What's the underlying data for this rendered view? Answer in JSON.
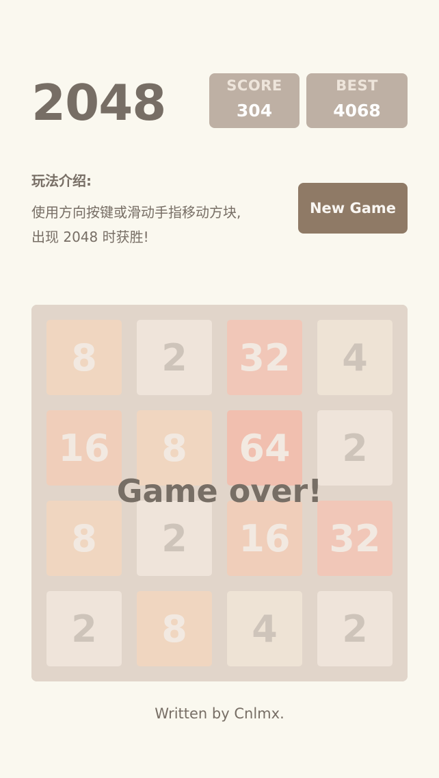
{
  "header": {
    "title": "2048",
    "score": {
      "label": "SCORE",
      "value": "304"
    },
    "best": {
      "label": "BEST",
      "value": "4068"
    }
  },
  "intro": {
    "heading": "玩法介绍:",
    "line1": "使用方向按键或滑动手指移动方块,",
    "line2": "出现 2048 时获胜!"
  },
  "controls": {
    "new_game_label": "New Game"
  },
  "board": {
    "rows": [
      [
        "8",
        "2",
        "32",
        "4"
      ],
      [
        "16",
        "8",
        "64",
        "2"
      ],
      [
        "8",
        "2",
        "16",
        "32"
      ],
      [
        "2",
        "8",
        "4",
        "2"
      ]
    ],
    "message": "Game over!"
  },
  "colors": {
    "background": "#faf8ef",
    "board": "#bbada0",
    "text": "#776e65",
    "button": "#8f7a66"
  },
  "footer": {
    "prefix": "Written by ",
    "author": "Cnlmx",
    "suffix": "."
  }
}
